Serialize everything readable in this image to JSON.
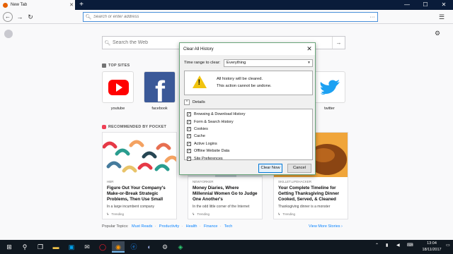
{
  "browser": {
    "tab_title": "New Tab",
    "tab_close": "✕",
    "new_tab_symbol": "+",
    "window_controls": [
      "—",
      "☐",
      "✕"
    ],
    "url_placeholder": "Search or enter address",
    "nav_glyphs": {
      "back": "←",
      "forward": "→",
      "reload": "↻",
      "menu": "☰",
      "page_actions": "···"
    }
  },
  "newtab": {
    "search_placeholder": "Search the Web",
    "search_go": "→",
    "top_sites_header": "TOP SITES",
    "top_sites": [
      {
        "label": "youtube",
        "color": "#ffffff",
        "icon": "youtube-logo"
      },
      {
        "label": "facebook",
        "color": "#3b5998",
        "icon": "facebook-logo"
      },
      {
        "label": "twitter",
        "color": "#ffffff",
        "icon": "twitter-logo"
      }
    ],
    "pocket_header": "RECOMMENDED BY POCKET",
    "stories": [
      {
        "source": "HBR",
        "title": "Figure Out Your Company's Make-or-Break Strategic Problems, Then Use Small",
        "description": "In a large incumbent company",
        "trend": "Trending"
      },
      {
        "source": "NEWYORKER",
        "title": "Money Diaries, Where Millennial Women Go to Judge One Another's",
        "description": "In the odd little corner of the Internet",
        "trend": "Trending"
      },
      {
        "source": "SKILLET.LIFEHACKER",
        "title": "Your Complete Timeline for Getting Thanksgiving Dinner Cooked, Served, & Cleaned",
        "description": "Thanksgiving dinner is a monster",
        "trend": "Trending"
      }
    ],
    "topics_label": "Popular Topics:",
    "topics": [
      "Must Reads",
      "Productivity",
      "Health",
      "Finance",
      "Tech"
    ],
    "more_stories": "View More Stories ›"
  },
  "dialog": {
    "title": "Clear All History",
    "close": "✕",
    "time_range_label": "Time range to clear:",
    "time_range_value": "Everything",
    "warning_line1": "All history will be cleared.",
    "warning_line2": "This action cannot be undone.",
    "details_label": "Details",
    "details_chevron": "^",
    "options": [
      {
        "label": "Browsing & Download History",
        "checked": true
      },
      {
        "label": "Form & Search History",
        "checked": true
      },
      {
        "label": "Cookies",
        "checked": true
      },
      {
        "label": "Cache",
        "checked": true
      },
      {
        "label": "Active Logins",
        "checked": true
      },
      {
        "label": "Offline Website Data",
        "checked": true
      },
      {
        "label": "Site Preferences",
        "checked": true
      }
    ],
    "check_glyph": "✓",
    "clear_button": "Clear Now",
    "cancel_button": "Cancel"
  },
  "taskbar": {
    "time": "13:04",
    "date": "18/11/2017",
    "glyphs": {
      "start": "⊞",
      "search": "⚲",
      "taskview": "❐",
      "tray": "⌃",
      "notify": "▭"
    }
  }
}
